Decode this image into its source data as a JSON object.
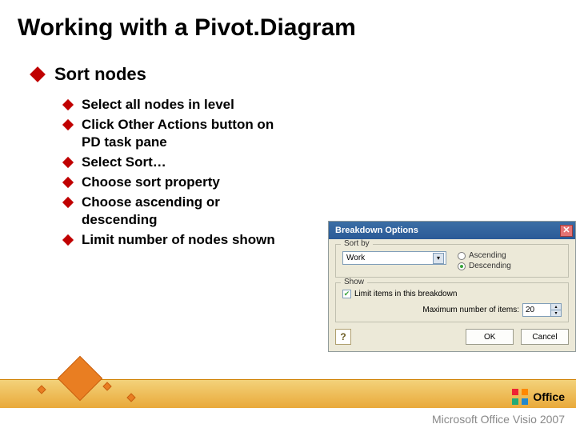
{
  "title": "Working with a Pivot.Diagram",
  "topBullet": "Sort nodes",
  "subBullets": [
    "Select all nodes in level",
    "Click Other Actions button on PD task pane",
    "Select Sort…",
    "Choose sort property",
    "Choose ascending or descending",
    "Limit number of nodes shown"
  ],
  "dialog": {
    "title": "Breakdown Options",
    "close": "✕",
    "group1": {
      "legend": "Sort by",
      "dropdownValue": "Work",
      "radio1": "Ascending",
      "radio2": "Descending"
    },
    "group2": {
      "legend": "Show",
      "checkboxLabel": "Limit items in this breakdown",
      "spinLabel": "Maximum number of items:",
      "spinValue": "20"
    },
    "help": "?",
    "ok": "OK",
    "cancel": "Cancel"
  },
  "footer": {
    "officeWord": "Office",
    "visioLine": "Microsoft Office Visio 2007"
  }
}
